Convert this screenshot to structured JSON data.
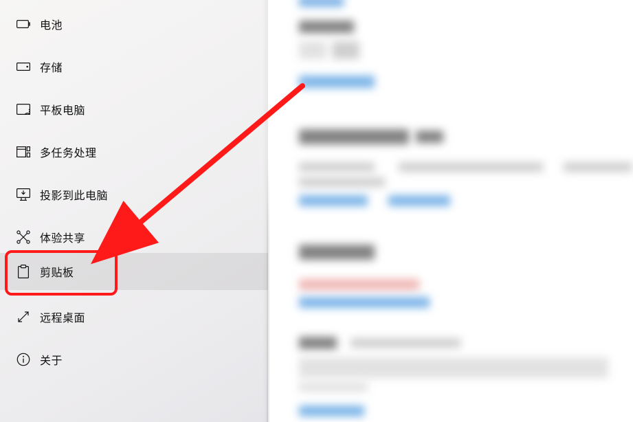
{
  "sidebar": {
    "items": [
      {
        "id": "battery",
        "label": "电池"
      },
      {
        "id": "storage",
        "label": "存储"
      },
      {
        "id": "tablet",
        "label": "平板电脑"
      },
      {
        "id": "multitask",
        "label": "多任务处理"
      },
      {
        "id": "project",
        "label": "投影到此电脑"
      },
      {
        "id": "shared",
        "label": "体验共享"
      },
      {
        "id": "clipboard",
        "label": "剪贴板"
      },
      {
        "id": "remote",
        "label": "远程桌面"
      },
      {
        "id": "about",
        "label": "关于"
      }
    ],
    "selected_index": 6
  },
  "annotation": {
    "highlight_target": "clipboard",
    "highlight_color": "#ff1a1a"
  }
}
